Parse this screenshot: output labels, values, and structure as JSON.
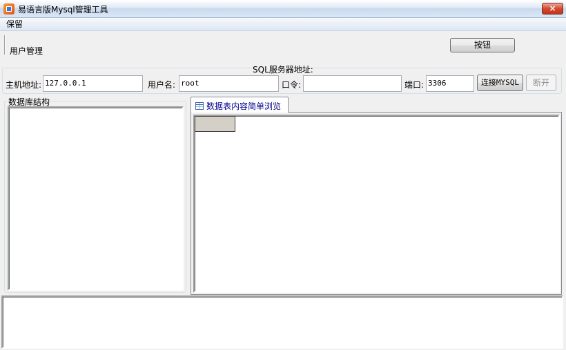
{
  "window": {
    "title": "易语言版Mysql管理工具",
    "close_label": "×"
  },
  "menu": {
    "items": [
      "保留"
    ]
  },
  "header": {
    "section_label": "用户管理",
    "button_label": "按钮"
  },
  "connection": {
    "group_label": "SQL服务器地址:",
    "host_label": "主机地址:",
    "host_value": "127.0.0.1",
    "user_label": "用户名:",
    "user_value": "root",
    "password_label": "口令:",
    "password_value": "",
    "port_label": "端口:",
    "port_value": "3306",
    "connect_label": "连接MYSQL",
    "disconnect_label": "断开"
  },
  "db_panel": {
    "label": "数据库结构"
  },
  "tabs": [
    {
      "label": "数据表内容简单浏览",
      "icon": "table-icon"
    }
  ],
  "log": {
    "value": ""
  }
}
